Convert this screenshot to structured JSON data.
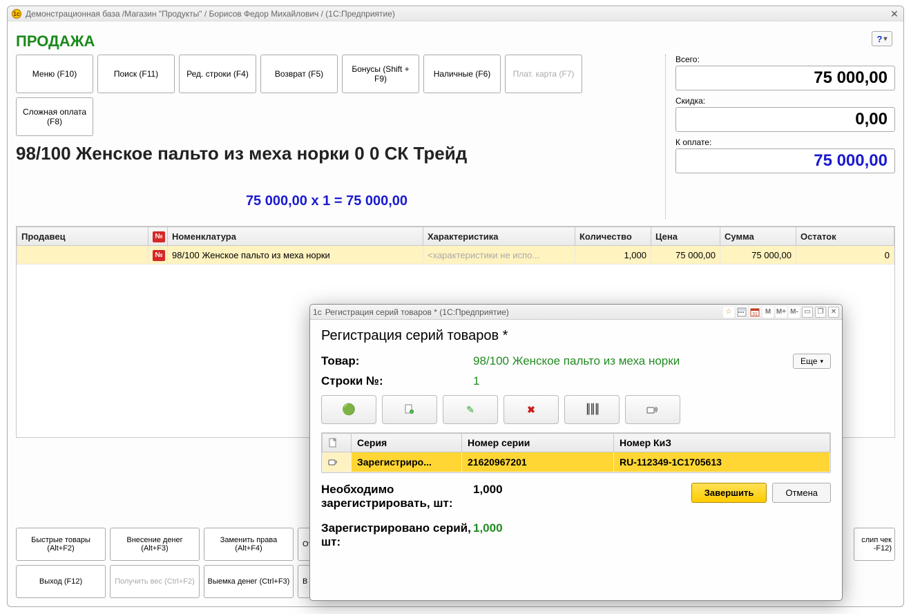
{
  "window": {
    "title": "Демонстрационная база /Магазин \"Продукты\" / Борисов Федор Михайлович / (1С:Предприятие)"
  },
  "page_title": "ПРОДАЖА",
  "toolbar": [
    {
      "label": "Меню (F10)",
      "disabled": false
    },
    {
      "label": "Поиск (F11)",
      "disabled": false
    },
    {
      "label": "Ред. строки (F4)",
      "disabled": false
    },
    {
      "label": "Возврат (F5)",
      "disabled": false
    },
    {
      "label": "Бонусы (Shift + F9)",
      "disabled": false
    },
    {
      "label": "Наличные (F6)",
      "disabled": false
    },
    {
      "label": "Плат. карта (F7)",
      "disabled": true
    },
    {
      "label": "Сложная оплата (F8)",
      "disabled": false
    }
  ],
  "totals": {
    "total_label": "Всего:",
    "total_value": "75 000,00",
    "discount_label": "Скидка:",
    "discount_value": "0,00",
    "topay_label": "К оплате:",
    "topay_value": "75 000,00"
  },
  "product_line": "98/100 Женское пальто из меха норки 0 0 СК Трейд",
  "calc_line": "75 000,00  x 1  = 75 000,00",
  "grid": {
    "headers": [
      "Продавец",
      "№",
      "Номенклатура",
      "Характеристика",
      "Количество",
      "Цена",
      "Сумма",
      "Остаток"
    ],
    "row": {
      "seller": "",
      "num_badge": "№",
      "name": "98/100 Женское пальто из меха норки",
      "char_placeholder": "<характеристики не испо...",
      "qty": "1,000",
      "price": "75 000,00",
      "sum": "75 000,00",
      "stock": "0"
    }
  },
  "bottom_row1": [
    {
      "label": "Быстрые товары (Alt+F2)",
      "disabled": false
    },
    {
      "label": "Внесение денег (Alt+F3)",
      "disabled": false
    },
    {
      "label": "Заменить права (Alt+F4)",
      "disabled": false
    },
    {
      "label": "Отлож",
      "disabled": false,
      "cut": true
    }
  ],
  "bottom_row2": [
    {
      "label": "Выход (F12)",
      "disabled": false
    },
    {
      "label": "Получить вес (Ctrl+F2)",
      "disabled": true
    },
    {
      "label": "Выемка денег (Ctrl+F3)",
      "disabled": false
    },
    {
      "label": "В",
      "disabled": false,
      "cut": true
    }
  ],
  "bottom_right": {
    "label": "слип чек -F12)"
  },
  "dialog": {
    "titlebar": "Регистрация серий товаров * (1С:Предприятие)",
    "tools": {
      "m1": "M",
      "m2": "M+",
      "m3": "M-"
    },
    "heading": "Регистрация серий товаров *",
    "product_label": "Товар:",
    "product_value": "98/100 Женское пальто из меха норки",
    "lines_label": "Строки №:",
    "lines_value": "1",
    "more": "Еще",
    "table": {
      "headers": [
        "",
        "Серия",
        "Номер серии",
        "Номер КиЗ"
      ],
      "row": {
        "series": "Зарегистриро...",
        "serial": "21620967201",
        "kiz": "RU-112349-1C1705613"
      }
    },
    "need_label": "Необходимо зарегистрировать, шт:",
    "need_value": "1,000",
    "reg_label": "Зарегистрировано серий, шт:",
    "reg_value": "1,000",
    "complete": "Завершить",
    "cancel": "Отмена"
  }
}
